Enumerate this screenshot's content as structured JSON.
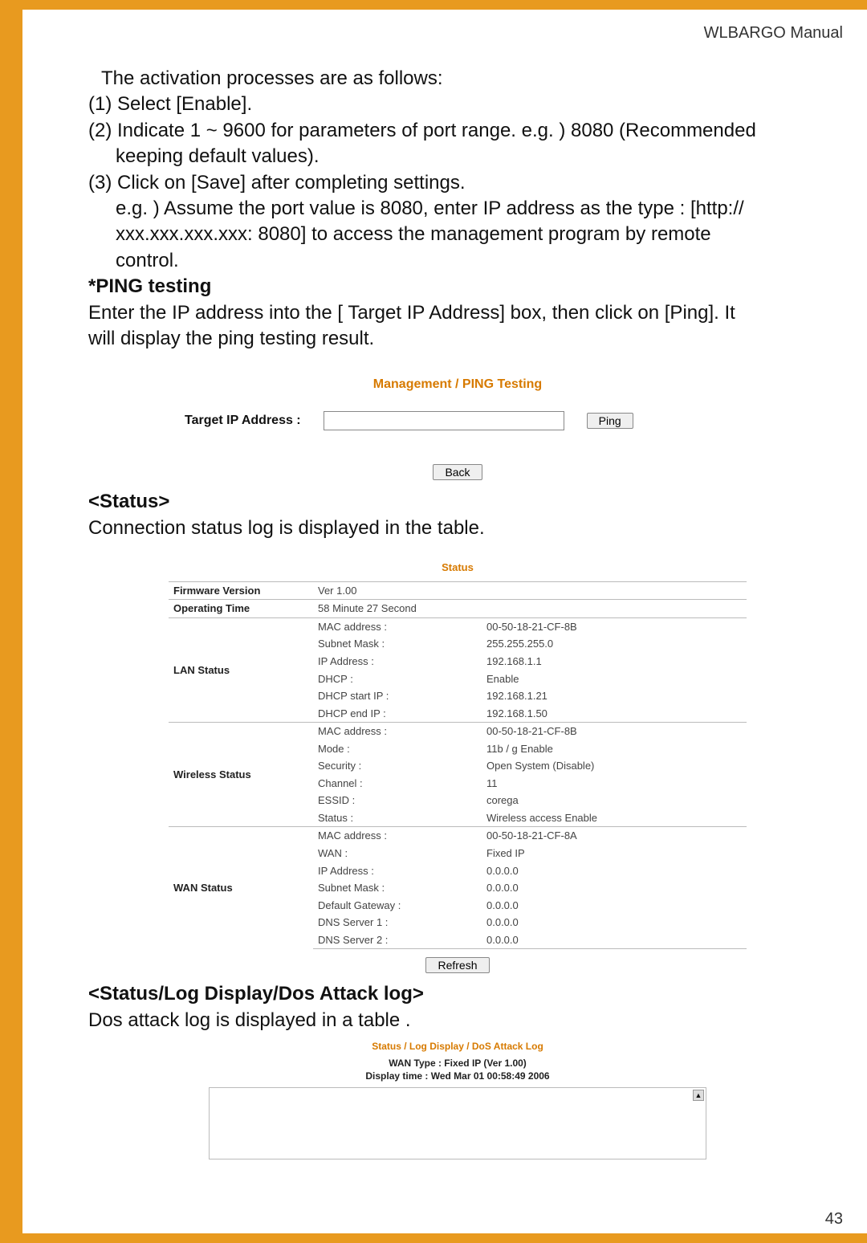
{
  "header": "WLBARGO Manual",
  "page_number": "43",
  "intro": {
    "line1": "The activation processes are as follows:",
    "step1": "(1) Select [Enable].",
    "step2": "(2) Indicate 1 ~ 9600 for parameters of port range. e.g. ) 8080 (Recommended",
    "step2b": "keeping default values).",
    "step3": "(3) Click on [Save] after completing settings.",
    "eg1": "e.g. ) Assume the port value is 8080, enter IP address as the type : [http://",
    "eg2": "xxx.xxx.xxx.xxx: 8080] to access the management program by remote",
    "eg3": "control."
  },
  "ping": {
    "heading": "*PING testing",
    "desc1": "Enter the IP address into the [ Target IP Address] box, then click on [Ping]. It",
    "desc2": "will display the ping testing result.",
    "panel_title": "Management / PING Testing",
    "label": "Target IP Address :",
    "ping_button": "Ping",
    "back_button": "Back"
  },
  "status": {
    "heading": "<Status>",
    "desc": "Connection status log is displayed in the table.",
    "panel_title": "Status",
    "rows": {
      "fw_label": "Firmware Version",
      "fw_value": "Ver 1.00",
      "op_label": "Operating Time",
      "op_value": "58 Minute 27 Second",
      "lan_label": "LAN Status",
      "lan": {
        "k1": "MAC address :",
        "v1": "00-50-18-21-CF-8B",
        "k2": "Subnet Mask :",
        "v2": "255.255.255.0",
        "k3": "IP Address :",
        "v3": "192.168.1.1",
        "k4": "DHCP :",
        "v4": "Enable",
        "k5": "DHCP start IP :",
        "v5": "192.168.1.21",
        "k6": "DHCP end IP :",
        "v6": "192.168.1.50"
      },
      "wifi_label": "Wireless Status",
      "wifi": {
        "k1": "MAC address :",
        "v1": "00-50-18-21-CF-8B",
        "k2": "Mode :",
        "v2": "11b / g Enable",
        "k3": "Security :",
        "v3": "Open System (Disable)",
        "k4": "Channel :",
        "v4": "11",
        "k5": "ESSID :",
        "v5": "corega",
        "k6": "Status :",
        "v6": "Wireless access Enable"
      },
      "wan_label": "WAN Status",
      "wan": {
        "k1": "MAC address :",
        "v1": "00-50-18-21-CF-8A",
        "k2": "WAN :",
        "v2": "Fixed IP",
        "k3": "IP Address :",
        "v3": "0.0.0.0",
        "k4": "Subnet Mask :",
        "v4": "0.0.0.0",
        "k5": "Default Gateway :",
        "v5": "0.0.0.0",
        "k6": "DNS Server 1 :",
        "v6": "0.0.0.0",
        "k7": "DNS Server 2 :",
        "v7": "0.0.0.0"
      }
    },
    "refresh_button": "Refresh"
  },
  "dos": {
    "heading": "<Status/Log Display/Dos Attack log>",
    "desc": "Dos attack log is displayed in a table .",
    "panel_title": "Status / Log Display / DoS Attack Log",
    "meta1": "WAN Type : Fixed IP (Ver 1.00)",
    "meta2": "Display time : Wed Mar 01 00:58:49 2006"
  }
}
